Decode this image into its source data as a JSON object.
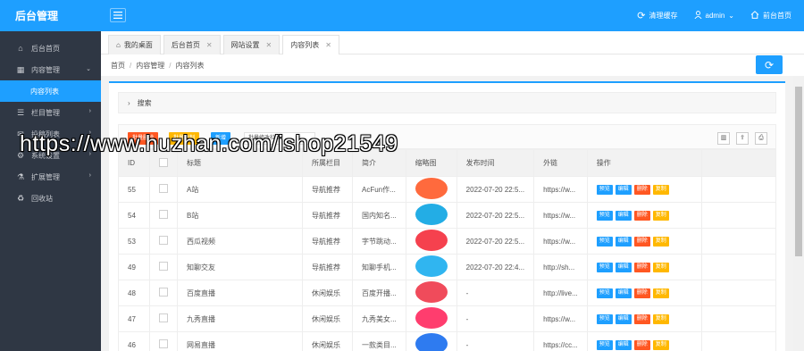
{
  "header": {
    "brand": "后台管理",
    "clear_cache": "清理缓存",
    "user": "admin",
    "front_home": "前台首页"
  },
  "sidebar": {
    "items": [
      {
        "label": "后台首页",
        "icon": "home-icon",
        "glyph": "⌂",
        "arrow": ""
      },
      {
        "label": "内容管理",
        "icon": "grid-icon",
        "glyph": "▦",
        "arrow": "⌄"
      },
      {
        "label": "内容列表",
        "icon": "",
        "glyph": "",
        "arrow": ""
      },
      {
        "label": "栏目管理",
        "icon": "list-icon",
        "glyph": "☰",
        "arrow": "›"
      },
      {
        "label": "投稿列表",
        "icon": "chat-icon",
        "glyph": "✉",
        "arrow": "›"
      },
      {
        "label": "系统设置",
        "icon": "gear-icon",
        "glyph": "⚙",
        "arrow": "›"
      },
      {
        "label": "扩展管理",
        "icon": "extension-icon",
        "glyph": "⚗",
        "arrow": "›"
      },
      {
        "label": "回收站",
        "icon": "trash-icon",
        "glyph": "♻",
        "arrow": ""
      }
    ]
  },
  "tabs": [
    {
      "label": "我的桌面",
      "closable": false
    },
    {
      "label": "后台首页",
      "closable": true
    },
    {
      "label": "网站设置",
      "closable": true
    },
    {
      "label": "内容列表",
      "closable": true
    }
  ],
  "breadcrumb": [
    "首页",
    "内容管理",
    "内容列表"
  ],
  "search_panel": {
    "label": "搜索"
  },
  "toolbar": {
    "batch_delete": "批量删除",
    "batch_copy": "批量复制",
    "add": "新增",
    "batch_column_select": "批量修改栏目"
  },
  "table": {
    "columns": [
      "ID",
      "",
      "标题",
      "所属栏目",
      "简介",
      "缩略图",
      "发布时间",
      "外链",
      "操作"
    ],
    "actions": [
      "预览",
      "编辑",
      "删除",
      "复制"
    ],
    "rows": [
      {
        "id": "55",
        "title": "A站",
        "category": "导航推荐",
        "intro": "AcFun作...",
        "thumb_color": "#ff6a3d",
        "time": "2022-07-20 22:5...",
        "link": "https://w..."
      },
      {
        "id": "54",
        "title": "B站",
        "category": "导航推荐",
        "intro": "国内知名...",
        "thumb_color": "#23ade5",
        "time": "2022-07-20 22:5...",
        "link": "https://w..."
      },
      {
        "id": "53",
        "title": "西瓜视频",
        "category": "导航推荐",
        "intro": "字节跳动...",
        "thumb_color": "#f5414e",
        "time": "2022-07-20 22:5...",
        "link": "https://w..."
      },
      {
        "id": "49",
        "title": "知聊交友",
        "category": "导航推荐",
        "intro": "知聊手机...",
        "thumb_color": "#30b5f0",
        "time": "2022-07-20 22:4...",
        "link": "http://sh..."
      },
      {
        "id": "48",
        "title": "百度直播",
        "category": "休闲娱乐",
        "intro": "百度开播...",
        "thumb_color": "#f04b5b",
        "time": "-",
        "link": "http://live..."
      },
      {
        "id": "47",
        "title": "九秀直播",
        "category": "休闲娱乐",
        "intro": "九秀美女...",
        "thumb_color": "#ff3d6e",
        "time": "-",
        "link": "https://w..."
      },
      {
        "id": "46",
        "title": "网易直播",
        "category": "休闲娱乐",
        "intro": "一款类目...",
        "thumb_color": "#2e7bf0",
        "time": "-",
        "link": "https://cc..."
      }
    ]
  },
  "watermark": "https://www.huzhan.com/ishop21549",
  "colors": {
    "primary": "#1e9fff",
    "danger": "#ff5722",
    "warning": "#ffb800",
    "sidebar": "#2f3744"
  }
}
